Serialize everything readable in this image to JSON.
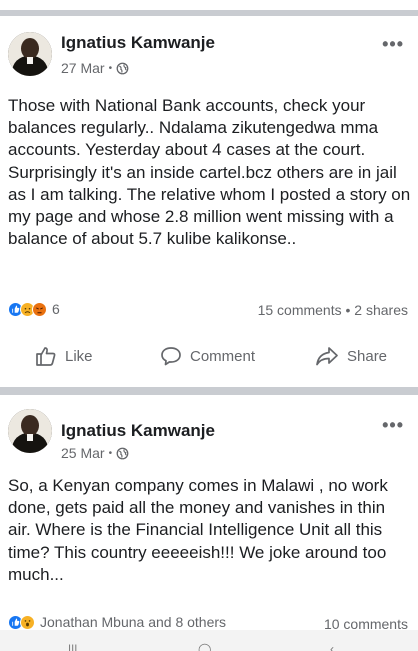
{
  "posts": [
    {
      "author": "Ignatius Kamwanje",
      "date": "27 Mar",
      "separator": "•",
      "body": "Those with National Bank accounts, check your balances regularly.. Ndalama zikutengedwa mma accounts. Yesterday about 4 cases at the court. Surprisingly it's an inside cartel.bcz others are in jail as I am talking. The relative whom I posted a story on my page and whose 2.8 million went missing with a balance of about 5.7 kulibe kalikonse..",
      "reactions_count": "6",
      "reaction_icons": [
        "like-icon",
        "sad-icon",
        "angry-icon"
      ],
      "counts": "15 comments • 2 shares",
      "actions": {
        "like": "Like",
        "comment": "Comment",
        "share": "Share"
      }
    },
    {
      "author": "Ignatius Kamwanje",
      "date": "25 Mar",
      "separator": "•",
      "body": "So, a Kenyan company comes in Malawi , no work done, gets paid all the money and vanishes in thin air. Where is the Financial Intelligence Unit all this time? This country eeeeeish!!! We joke around too much...",
      "reactions_by": "Jonathan Mbuna and 8 others",
      "reaction_icons": [
        "like-icon",
        "wow-icon"
      ],
      "counts": "10 comments"
    }
  ],
  "more_label": "•••",
  "colors": {
    "text": "#1c1e21",
    "secondary": "#65676b",
    "like_blue": "#1877f2",
    "divider": "#c9ccd1"
  }
}
